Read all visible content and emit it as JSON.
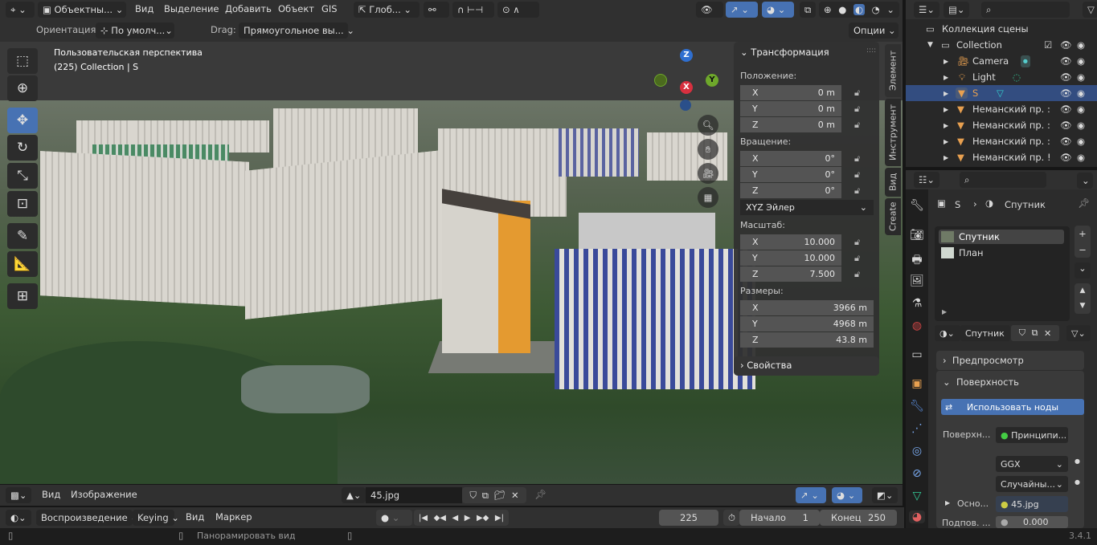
{
  "viewport_header": {
    "mode": "Объектны...",
    "menus": [
      "Вид",
      "Выделение",
      "Добавить",
      "Объект",
      "GIS"
    ],
    "transform_orientation": "Глоб..."
  },
  "tool_settings": {
    "orientation_label": "Ориентация:",
    "orientation_value": "По умолч...",
    "drag_label": "Drag:",
    "drag_value": "Прямоугольное вы...",
    "options": "Опции"
  },
  "viewport": {
    "view_name": "Пользовательская перспектива",
    "object_info": "(225) Collection | S",
    "gizmo": {
      "x": "X",
      "y": "Y",
      "z": "Z"
    }
  },
  "n_panel": {
    "transform_title": "Трансформация",
    "location_label": "Положение:",
    "location": [
      {
        "axis": "X",
        "value": "0 m"
      },
      {
        "axis": "Y",
        "value": "0 m"
      },
      {
        "axis": "Z",
        "value": "0 m"
      }
    ],
    "rotation_label": "Вращение:",
    "rotation": [
      {
        "axis": "X",
        "value": "0°"
      },
      {
        "axis": "Y",
        "value": "0°"
      },
      {
        "axis": "Z",
        "value": "0°"
      }
    ],
    "rotation_mode": "XYZ Эйлер",
    "scale_label": "Масштаб:",
    "scale": [
      {
        "axis": "X",
        "value": "10.000"
      },
      {
        "axis": "Y",
        "value": "10.000"
      },
      {
        "axis": "Z",
        "value": "7.500"
      }
    ],
    "dimensions_label": "Размеры:",
    "dimensions": [
      {
        "axis": "X",
        "value": "3966 m"
      },
      {
        "axis": "Y",
        "value": "4968 m"
      },
      {
        "axis": "Z",
        "value": "43.8 m"
      }
    ],
    "properties_title": "Свойства",
    "tabs": [
      "Элемент",
      "Инструмент",
      "Вид",
      "Create"
    ]
  },
  "outliner": {
    "scene_collection": "Коллекция сцены",
    "items": [
      {
        "name": "Collection",
        "type": "collection"
      },
      {
        "name": "Camera",
        "type": "camera"
      },
      {
        "name": "Light",
        "type": "light"
      },
      {
        "name": "S",
        "type": "mesh",
        "selected": true
      },
      {
        "name": "Неманский пр. :",
        "type": "mesh"
      },
      {
        "name": "Неманский пр. :",
        "type": "mesh"
      },
      {
        "name": "Неманский пр. :",
        "type": "mesh"
      },
      {
        "name": "Неманский пр. !",
        "type": "mesh"
      }
    ]
  },
  "properties": {
    "breadcrumb": {
      "object": "S",
      "material": "Спутник"
    },
    "material_slots": [
      "Спутник",
      "План"
    ],
    "material_name": "Спутник",
    "preview": "Предпросмотр",
    "surface": "Поверхность",
    "use_nodes": "Использовать ноды",
    "surface_label": "Поверхн...",
    "surface_value": "Принципи...",
    "distribution": "GGX",
    "subsurface_method": "Случайны...",
    "base_label": "Осно...",
    "base_value": "45.jpg",
    "subsurface_label": "Подпов. ...",
    "subsurface_value": "0.000"
  },
  "image_editor": {
    "menus": [
      "Вид",
      "Изображение"
    ],
    "image": "45.jpg"
  },
  "timeline": {
    "playback": "Воспроизведение",
    "keying": "Keying",
    "menus": [
      "Вид",
      "Маркер"
    ],
    "current_frame": "225",
    "start_label": "Начало",
    "start": "1",
    "end_label": "Конец",
    "end": "250"
  },
  "status_bar": {
    "hint": "Панорамировать вид",
    "version": "3.4.1"
  },
  "colors": {
    "accent": "#4772b3",
    "selected_row": "#334d80",
    "object_orange": "#e8a050"
  }
}
